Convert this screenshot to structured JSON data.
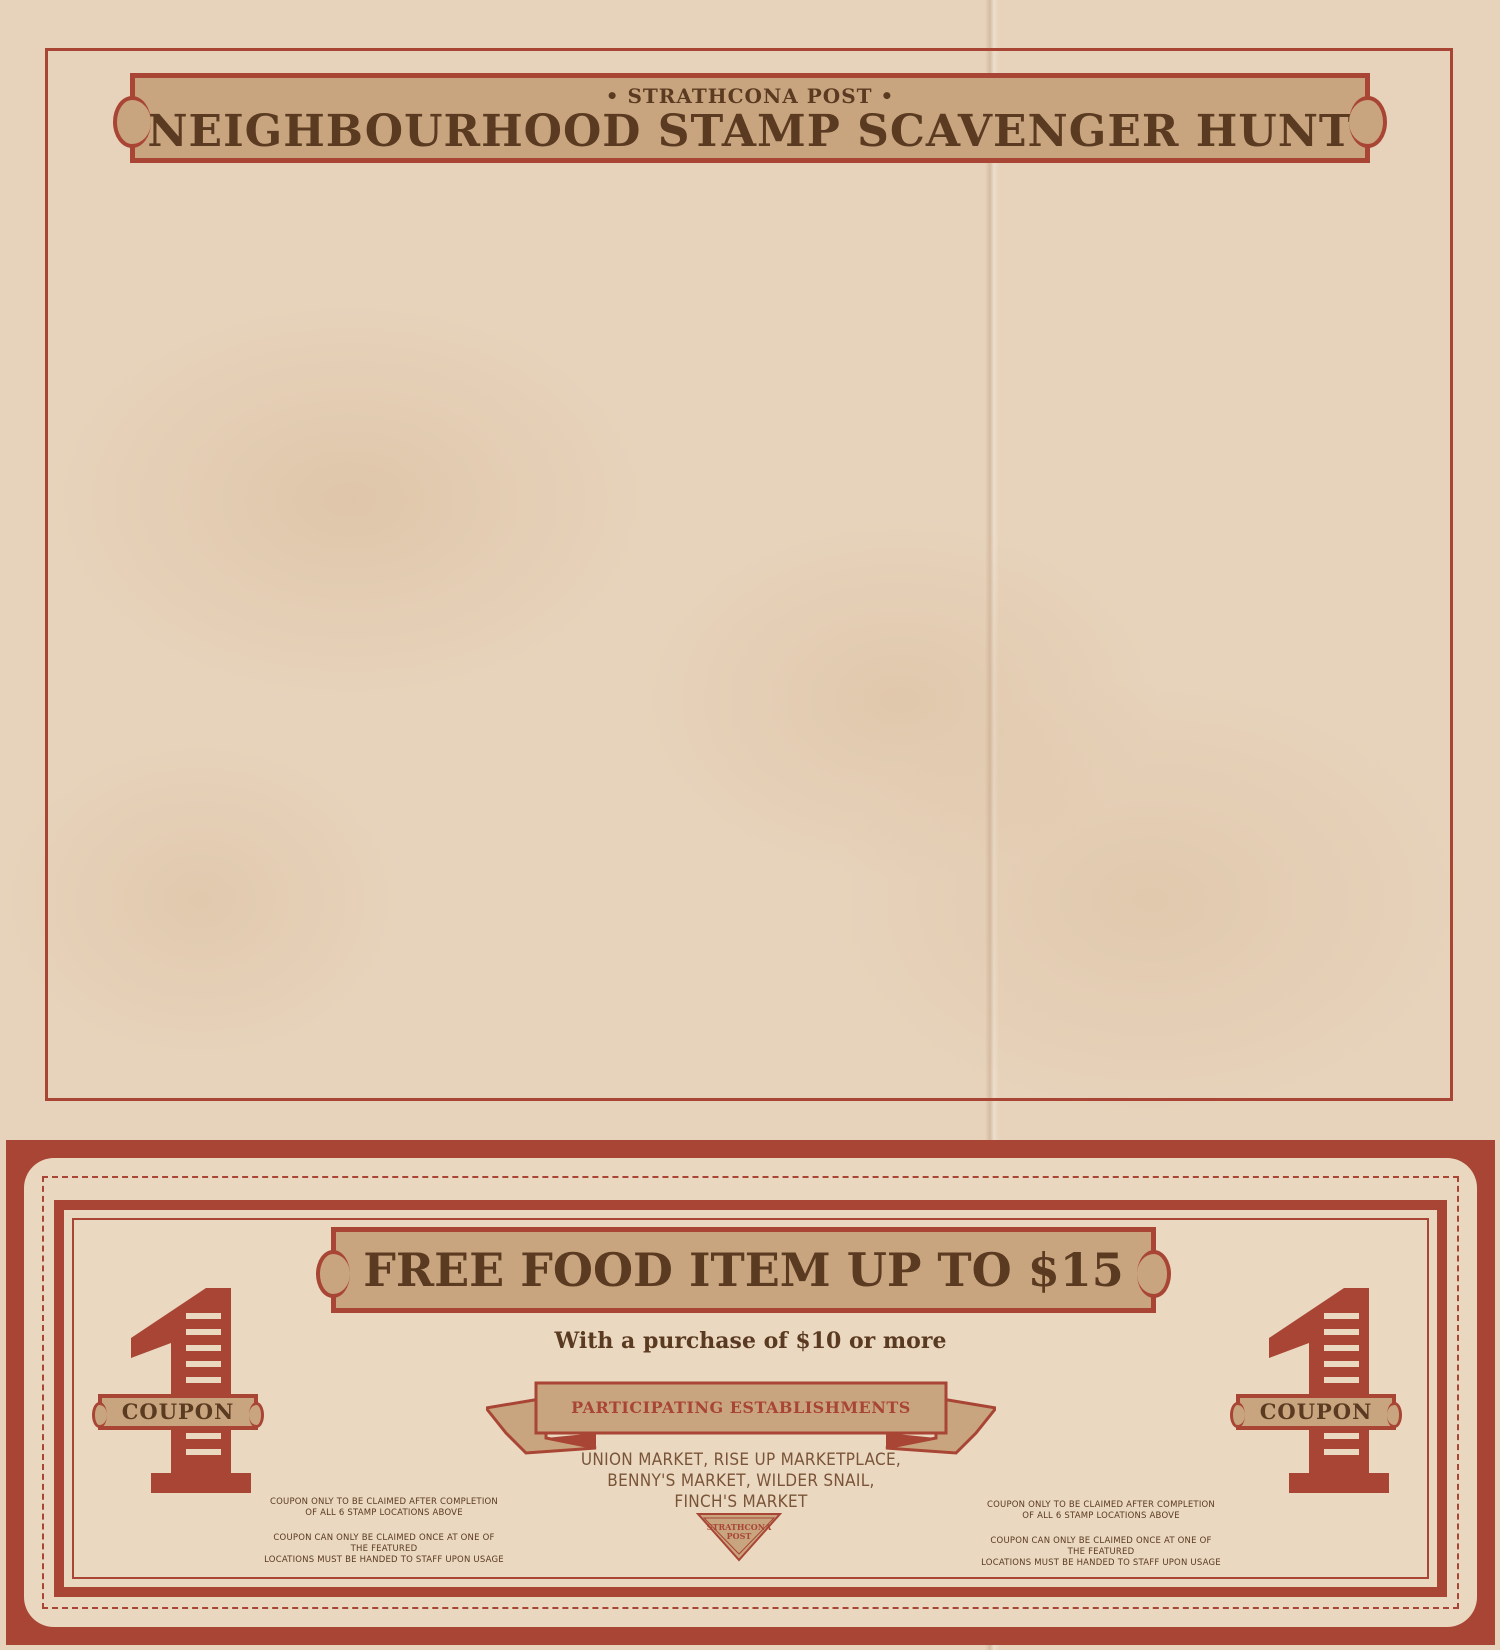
{
  "header": {
    "kicker": "• STRATHCONA POST •",
    "title": "NEIGHBOURHOOD STAMP SCAVENGER HUNT"
  },
  "coupon": {
    "offer": "FREE FOOD ITEM UP TO $15",
    "condition": "With a purchase of $10 or more",
    "participating_label": "PARTICIPATING ESTABLISHMENTS",
    "establishments": [
      "UNION MARKET, RISE UP MARKETPLACE,",
      "BENNY'S MARKET, WILDER SNAIL,",
      "FINCH'S MARKET"
    ],
    "seal_text": "STRATHCONA POST",
    "left_tag": "COUPON",
    "right_tag": "COUPON",
    "number": "1",
    "fine_print_left": {
      "line1": "COUPON ONLY TO BE CLAIMED AFTER COMPLETION",
      "line2": "OF ALL 6 STAMP LOCATIONS ABOVE",
      "line3": "COUPON CAN ONLY BE CLAIMED ONCE AT ONE OF THE FEATURED",
      "line4": "LOCATIONS MUST BE HANDED TO STAFF UPON USAGE"
    },
    "fine_print_right": {
      "line1": "COUPON ONLY TO BE CLAIMED AFTER COMPLETION",
      "line2": "OF ALL 6 STAMP LOCATIONS ABOVE",
      "line3": "COUPON CAN ONLY BE CLAIMED ONCE AT ONE OF THE FEATURED",
      "line4": "LOCATIONS MUST BE HANDED TO STAFF UPON USAGE"
    }
  },
  "colors": {
    "paper": "#e7d3bb",
    "accent_red": "#a84535",
    "banner_tan": "#c9a57f",
    "ink_brown": "#5a3a20"
  }
}
